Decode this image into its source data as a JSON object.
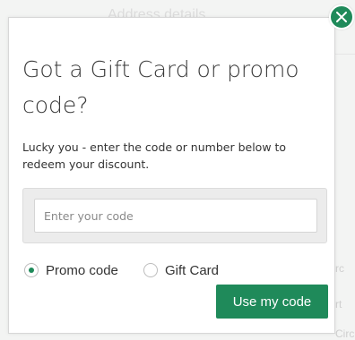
{
  "background": {
    "heading": "Address details",
    "side_texts": [
      "rc",
      "rt",
      "Circ"
    ]
  },
  "modal": {
    "title": "Got a Gift Card or promo code?",
    "subtitle": "Lucky you - enter the code or number below to redeem your discount.",
    "code_input": {
      "placeholder": "Enter your code",
      "value": ""
    },
    "options": [
      {
        "label": "Promo code",
        "selected": true
      },
      {
        "label": "Gift Card",
        "selected": false
      }
    ],
    "submit_label": "Use my code",
    "close_icon": "close-icon"
  },
  "colors": {
    "accent": "#1f8a5a",
    "text": "#333333",
    "panel_bg": "#ececec"
  }
}
